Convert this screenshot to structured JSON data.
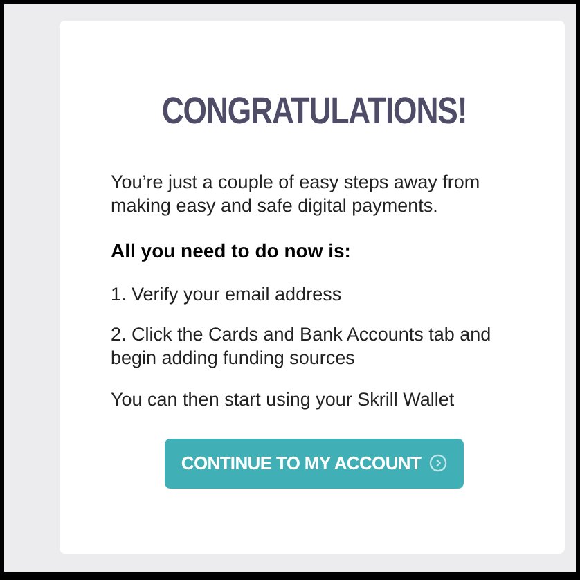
{
  "title": "CONGRATULATIONS!",
  "intro": "You’re just a couple of easy steps away from making easy and safe digital payments.",
  "subheading": "All you need to do now is:",
  "steps": [
    "1. Verify your email address",
    "2. Click the Cards and Bank Accounts tab and begin adding funding sources"
  ],
  "closing": "You can then start using your Skrill Wallet",
  "button": {
    "label": "CONTINUE TO MY ACCOUNT"
  }
}
